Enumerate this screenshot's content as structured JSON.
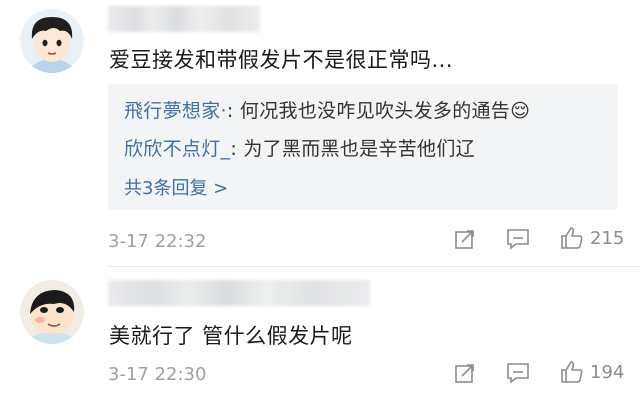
{
  "comments": [
    {
      "text": "爱豆接发和带假发片不是很正常吗...",
      "time": "3-17 22:32",
      "likes": "215",
      "replies": [
        {
          "author": "飛行夢想家·",
          "separator": ": ",
          "text": "何况我也没咋见吹头发多的通告",
          "emoji": "😌"
        },
        {
          "author": "欣欣不点灯_",
          "separator": ": ",
          "text": "为了黑而黑也是辛苦他们辽"
        }
      ],
      "more_replies": "共3条回复 >"
    },
    {
      "text": "美就行了 管什么假发片呢",
      "time": "3-17 22:30",
      "likes": "194"
    }
  ],
  "icons": {
    "share": "share-icon",
    "comment": "comment-icon",
    "like": "thumbs-up-icon"
  },
  "colors": {
    "link": "#3f6fa6",
    "text": "#1a1a1a",
    "muted": "#a0a0a0",
    "reply_bg": "#f3f4f5"
  }
}
